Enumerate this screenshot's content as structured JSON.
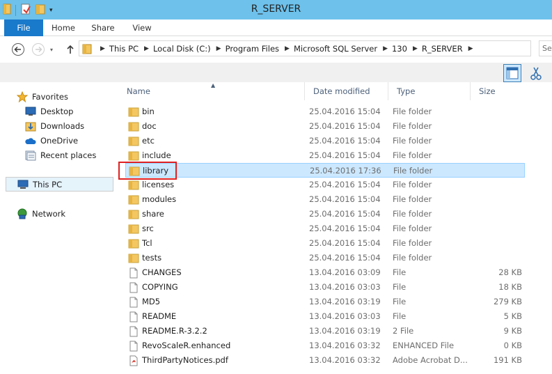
{
  "window": {
    "title": "R_SERVER"
  },
  "ribbon": {
    "tabs": [
      "File",
      "Home",
      "Share",
      "View"
    ]
  },
  "address": {
    "crumbs": [
      "This PC",
      "Local Disk (C:)",
      "Program Files",
      "Microsoft SQL Server",
      "130",
      "R_SERVER"
    ],
    "search_placeholder": "Se"
  },
  "nav": {
    "favorites_label": "Favorites",
    "items": [
      {
        "label": "Desktop",
        "icon": "desktop-icon"
      },
      {
        "label": "Downloads",
        "icon": "downloads-icon"
      },
      {
        "label": "OneDrive",
        "icon": "onedrive-icon"
      },
      {
        "label": "Recent places",
        "icon": "recent-places-icon"
      }
    ],
    "this_pc": "This PC",
    "network": "Network"
  },
  "columns": {
    "name": "Name",
    "date": "Date modified",
    "type": "Type",
    "size": "Size"
  },
  "files": [
    {
      "name": "bin",
      "date": "25.04.2016 15:04",
      "type": "File folder",
      "size": "",
      "icon": "folder-icon"
    },
    {
      "name": "doc",
      "date": "25.04.2016 15:04",
      "type": "File folder",
      "size": "",
      "icon": "folder-icon"
    },
    {
      "name": "etc",
      "date": "25.04.2016 15:04",
      "type": "File folder",
      "size": "",
      "icon": "folder-icon"
    },
    {
      "name": "include",
      "date": "25.04.2016 15:04",
      "type": "File folder",
      "size": "",
      "icon": "folder-icon"
    },
    {
      "name": "library",
      "date": "25.04.2016 17:36",
      "type": "File folder",
      "size": "",
      "icon": "folder-icon",
      "selected": true
    },
    {
      "name": "licenses",
      "date": "25.04.2016 15:04",
      "type": "File folder",
      "size": "",
      "icon": "folder-icon"
    },
    {
      "name": "modules",
      "date": "25.04.2016 15:04",
      "type": "File folder",
      "size": "",
      "icon": "folder-icon"
    },
    {
      "name": "share",
      "date": "25.04.2016 15:04",
      "type": "File folder",
      "size": "",
      "icon": "folder-icon"
    },
    {
      "name": "src",
      "date": "25.04.2016 15:04",
      "type": "File folder",
      "size": "",
      "icon": "folder-icon"
    },
    {
      "name": "Tcl",
      "date": "25.04.2016 15:04",
      "type": "File folder",
      "size": "",
      "icon": "folder-icon"
    },
    {
      "name": "tests",
      "date": "25.04.2016 15:04",
      "type": "File folder",
      "size": "",
      "icon": "folder-icon"
    },
    {
      "name": "CHANGES",
      "date": "13.04.2016 03:09",
      "type": "File",
      "size": "28 KB",
      "icon": "file-icon"
    },
    {
      "name": "COPYING",
      "date": "13.04.2016 03:03",
      "type": "File",
      "size": "18 KB",
      "icon": "file-icon"
    },
    {
      "name": "MD5",
      "date": "13.04.2016 03:19",
      "type": "File",
      "size": "279 KB",
      "icon": "file-icon"
    },
    {
      "name": "README",
      "date": "13.04.2016 03:03",
      "type": "File",
      "size": "5 KB",
      "icon": "file-icon"
    },
    {
      "name": "README.R-3.2.2",
      "date": "13.04.2016 03:19",
      "type": "2 File",
      "size": "9 KB",
      "icon": "file-icon"
    },
    {
      "name": "RevoScaleR.enhanced",
      "date": "13.04.2016 03:32",
      "type": "ENHANCED File",
      "size": "0 KB",
      "icon": "file-icon"
    },
    {
      "name": "ThirdPartyNotices.pdf",
      "date": "13.04.2016 03:32",
      "type": "Adobe Acrobat D...",
      "size": "191 KB",
      "icon": "pdf-icon"
    }
  ],
  "colors": {
    "titlebar": "#6dc1eb",
    "file_tab": "#1979ca",
    "selection": "#cce8ff",
    "highlight": "#e02020"
  }
}
